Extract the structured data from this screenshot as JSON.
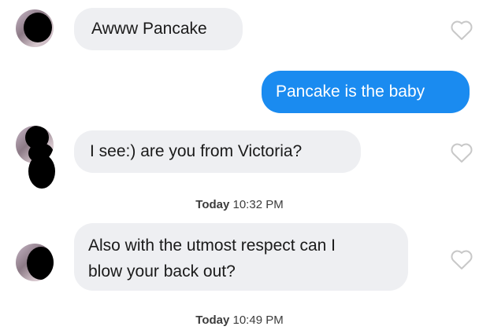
{
  "conversation": {
    "messages": [
      {
        "direction": "incoming",
        "text": "Awww Pancake"
      },
      {
        "direction": "outgoing",
        "text": "Pancake is the baby"
      },
      {
        "direction": "incoming",
        "text": "I see:) are you from Victoria?"
      },
      {
        "direction": "incoming",
        "lines": [
          "Also with the utmost respect can I",
          "blow your back out?"
        ]
      }
    ],
    "timestamps": [
      {
        "day": "Today",
        "time": "10:32 PM"
      },
      {
        "day": "Today",
        "time": "10:49 PM"
      }
    ]
  },
  "icons": {
    "like": "heart-outline-icon"
  },
  "colors": {
    "incoming_bubble": "#eeeff2",
    "outgoing_bubble": "#1a8bf0",
    "heart_outline": "#c8c8c8"
  }
}
